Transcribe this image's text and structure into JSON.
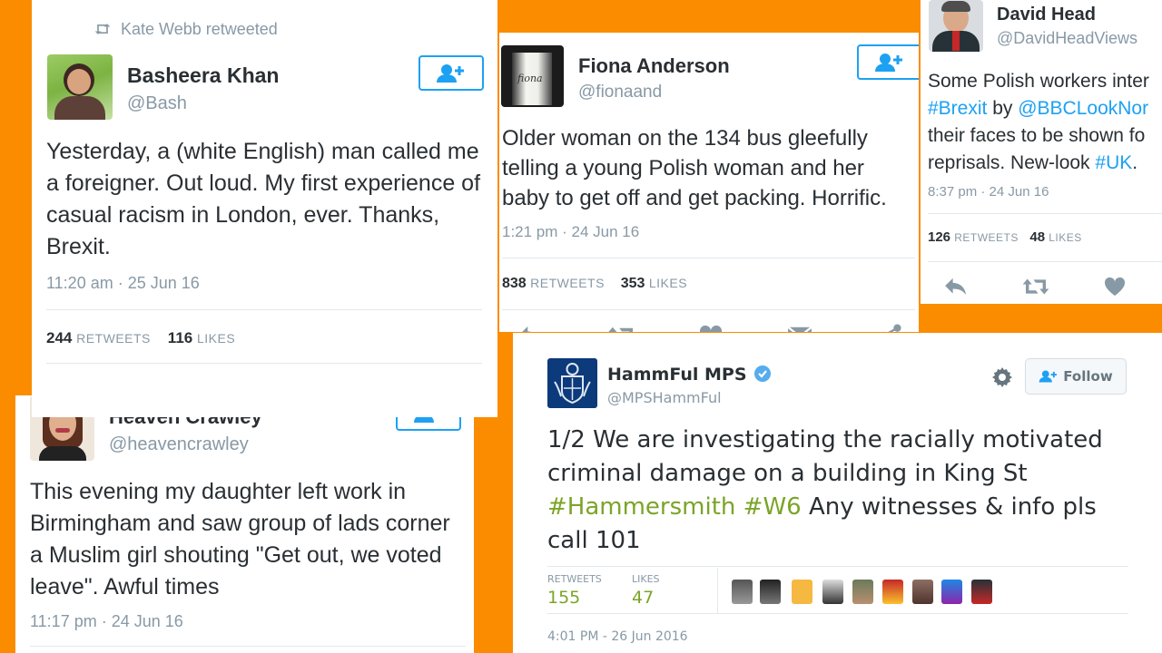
{
  "bash": {
    "retweeted_by": "Kate Webb retweeted",
    "name": "Basheera Khan",
    "handle": "@Bash",
    "text": "Yesterday, a (white English) man called me a foreigner. Out loud. My first experience of casual racism in London, ever. Thanks, Brexit.",
    "time": "11:20 am · 25 Jun 16",
    "retweets": "244",
    "retweets_label": "RETWEETS",
    "likes": "116",
    "likes_label": "LIKES"
  },
  "fiona": {
    "name": "Fiona Anderson",
    "handle": "@fionaand",
    "avatar_text": "fiona",
    "text": "Older woman on the 134 bus gleefully telling a young Polish woman and her baby to get off and get packing. Horrific.",
    "time": "1:21 pm · 24 Jun 16",
    "retweets": "838",
    "retweets_label": "RETWEETS",
    "likes": "353",
    "likes_label": "LIKES"
  },
  "david": {
    "name": "David Head",
    "handle": "@DavidHeadViews",
    "line1": "Some Polish workers inter",
    "line2_tag": "#Brexit",
    "line2_mid": " by ",
    "line2_mention": "@BBCLookNor",
    "line3": "their faces to be shown fo",
    "line4_pre": "reprisals. New-look ",
    "line4_tag": "#UK",
    "line4_post": ".",
    "time": "8:37 pm · 24 Jun 16",
    "retweets": "126",
    "retweets_label": "RETWEETS",
    "likes": "48",
    "likes_label": "LIKES"
  },
  "heaven": {
    "name": "Heaven Crawley",
    "handle": "@heavencrawley",
    "text": "This evening my daughter left work in Birmingham and saw group of lads corner a Muslim girl shouting \"Get out, we voted leave\". Awful times",
    "time": "11:17 pm · 24 Jun 16"
  },
  "mps": {
    "name": "HammFul MPS",
    "handle": "@MPSHammFul",
    "follow_label": "Follow",
    "text_pre": "1/2 We are investigating the racially motivated criminal damage on a building in King St ",
    "tag1": "#Hammersmith",
    "space": " ",
    "tag2": "#W6",
    "text_post": " Any witnesses & info pls call 101",
    "retweets_label": "RETWEETS",
    "retweets": "155",
    "likes_label": "LIKES",
    "likes": "47",
    "time": "4:01 PM - 26 Jun 2016"
  },
  "icons": [
    "retweet-icon",
    "follow-user-icon",
    "reply-icon",
    "like-icon",
    "message-icon",
    "share-icon",
    "gear-icon",
    "verified-icon"
  ],
  "colors": {
    "background": "#fb8c00",
    "twitter_blue": "#1da1f2",
    "hashtag_green": "#7ba428",
    "verified": "#55acee"
  }
}
